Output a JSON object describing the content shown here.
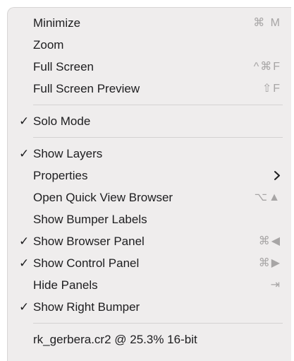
{
  "menu": {
    "groups": [
      [
        {
          "label": "Minimize",
          "checked": false,
          "shortcut": "⌘ M"
        },
        {
          "label": "Zoom",
          "checked": false,
          "shortcut": ""
        },
        {
          "label": "Full Screen",
          "checked": false,
          "shortcut": "^⌘F"
        },
        {
          "label": "Full Screen Preview",
          "checked": false,
          "shortcut": "⇧F"
        }
      ],
      [
        {
          "label": "Solo Mode",
          "checked": true,
          "shortcut": ""
        }
      ],
      [
        {
          "label": "Show Layers",
          "checked": true,
          "shortcut": ""
        },
        {
          "label": "Properties",
          "checked": false,
          "shortcut": "",
          "submenu": true
        },
        {
          "label": "Open Quick View Browser",
          "checked": false,
          "shortcut": "⌥▲"
        },
        {
          "label": "Show Bumper Labels",
          "checked": false,
          "shortcut": ""
        },
        {
          "label": "Show Browser Panel",
          "checked": true,
          "shortcut": "⌘◀"
        },
        {
          "label": "Show Control Panel",
          "checked": true,
          "shortcut": "⌘▶"
        },
        {
          "label": "Hide Panels",
          "checked": false,
          "shortcut": "⇥"
        },
        {
          "label": "Show Right Bumper",
          "checked": true,
          "shortcut": ""
        }
      ],
      [
        {
          "label": "rk_gerbera.cr2 @ 25.3% 16-bit",
          "checked": false,
          "shortcut": ""
        }
      ]
    ],
    "check_glyph": "✓",
    "submenu_icon": "chevron-right-icon"
  }
}
